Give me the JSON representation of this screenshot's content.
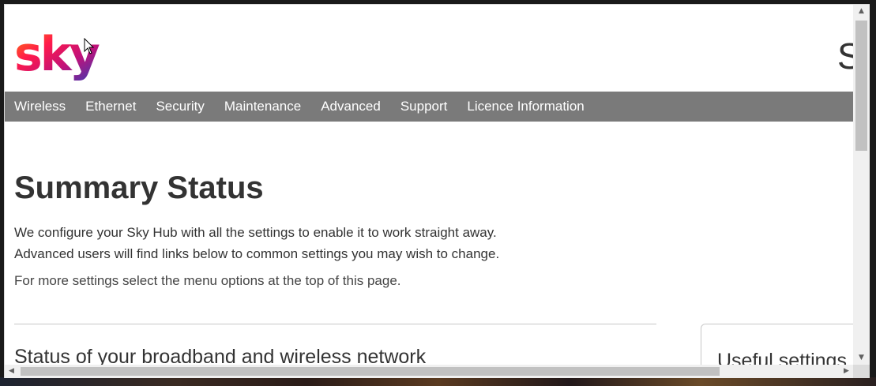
{
  "brand": {
    "logo_text": "sky",
    "header_partial_text": "S"
  },
  "nav": {
    "items": [
      {
        "label": "Wireless"
      },
      {
        "label": "Ethernet"
      },
      {
        "label": "Security"
      },
      {
        "label": "Maintenance"
      },
      {
        "label": "Advanced"
      },
      {
        "label": "Support"
      },
      {
        "label": "Licence Information"
      }
    ]
  },
  "main": {
    "title": "Summary Status",
    "intro_line1": "We configure your Sky Hub with all the settings to enable it to work straight away.",
    "intro_line2": "Advanced users will find links below to common settings you may wish to change.",
    "more_settings": "For more settings select the menu options at the top of this page.",
    "status_heading": "Status of your broadband and wireless network"
  },
  "sidebar": {
    "useful_heading": "Useful settings"
  },
  "colors": {
    "nav_bg": "#7a7a7a",
    "text": "#333333",
    "divider": "#c8c8c8"
  }
}
